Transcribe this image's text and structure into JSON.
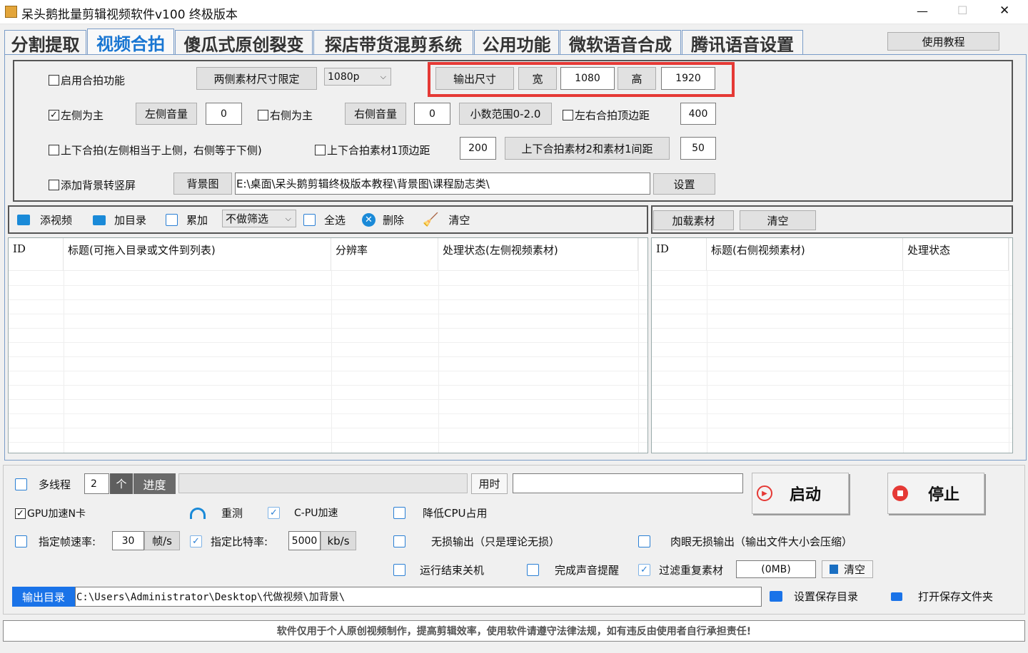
{
  "window": {
    "title": "呆头鹅批量剪辑视频软件v100 终极版本",
    "controls": [
      "—",
      "☐",
      "✕"
    ]
  },
  "tabs": [
    {
      "label": "分割提取"
    },
    {
      "label": "视频合拍",
      "active": true
    },
    {
      "label": "傻瓜式原创裂变"
    },
    {
      "label": "探店带货混剪系统"
    },
    {
      "label": "公用功能"
    },
    {
      "label": "微软语音合成"
    },
    {
      "label": "腾讯语音设置"
    }
  ],
  "tutorial_button": "使用教程",
  "settings": {
    "enable_merge": "启用合拍功能",
    "size_limit_button": "两侧素材尺寸限定",
    "resolution_select": "1080p",
    "output_size_button": "输出尺寸",
    "width_button": "宽",
    "width_value": "1080",
    "height_button": "高",
    "height_value": "1920",
    "left_main": "左侧为主",
    "left_volume_button": "左侧音量",
    "left_volume_value": "0",
    "right_main": "右侧为主",
    "right_volume_button": "右侧音量",
    "right_volume_value": "0",
    "decimal_range_button": "小数范围0-2.0",
    "lr_top_margin": "左右合拍顶边距",
    "lr_top_margin_value": "400",
    "tb_merge": "上下合拍(左侧相当于上侧，右侧等于下侧)",
    "tb_top_margin": "上下合拍素材1顶边距",
    "tb_top_margin_value": "200",
    "tb_gap_button": "上下合拍素材2和素材1间距",
    "tb_gap_value": "50",
    "add_bg": "添加背景转竖屏",
    "bg_button": "背景图",
    "bg_path": "E:\\桌面\\呆头鹅剪辑终极版本教程\\背景图\\课程励志类\\",
    "set_button": "设置"
  },
  "left_toolbar": {
    "add_video": "添视频",
    "add_dir": "加目录",
    "accumulate": "累加",
    "filter_select": "不做筛选",
    "select_all": "全选",
    "delete": "删除",
    "clear": "清空"
  },
  "right_toolbar": {
    "load_material": "加载素材",
    "clear": "清空"
  },
  "left_table": {
    "columns": [
      "ID",
      "标题(可拖入目录或文件到列表)",
      "分辨率",
      "处理状态(左侧视频素材)"
    ]
  },
  "right_table": {
    "columns": [
      "ID",
      "标题(右侧视频素材)",
      "处理状态"
    ]
  },
  "bottom": {
    "multithread": "多线程",
    "thread_count": "2",
    "thread_unit": "个",
    "progress_label": "进度",
    "time_label": "用时",
    "start_button": "启动",
    "stop_button": "停止",
    "gpu": "GPU加速N卡",
    "retest": "重测",
    "cpu_accel": "C-PU加速",
    "reduce_cpu": "降低CPU占用",
    "frame_rate": "指定帧速率:",
    "frame_rate_value": "30",
    "frame_rate_unit": "帧/s",
    "bitrate": "指定比特率:",
    "bitrate_value": "5000",
    "bitrate_unit": "kb/s",
    "lossless": "无损输出（只是理论无损）",
    "visual_lossless": "肉眼无损输出（输出文件大小会压缩）",
    "shutdown": "运行结束关机",
    "sound_alert": "完成声音提醒",
    "filter_dup": "过滤重复素材",
    "dup_value": "(0MB)",
    "clear_button": "清空",
    "output_dir_label": "输出目录",
    "output_dir_value": "C:\\Users\\Administrator\\Desktop\\代做视频\\加背景\\",
    "set_save_dir": "设置保存目录",
    "open_save_dir": "打开保存文件夹"
  },
  "footer": "软件仅用于个人原创视频制作，提高剪辑效率，使用软件请遵守法律法规，如有违反由使用者自行承担责任!",
  "colors": {
    "accent": "#1976d2",
    "highlight": "#e53935",
    "output_label_bg": "#1a73e8"
  }
}
